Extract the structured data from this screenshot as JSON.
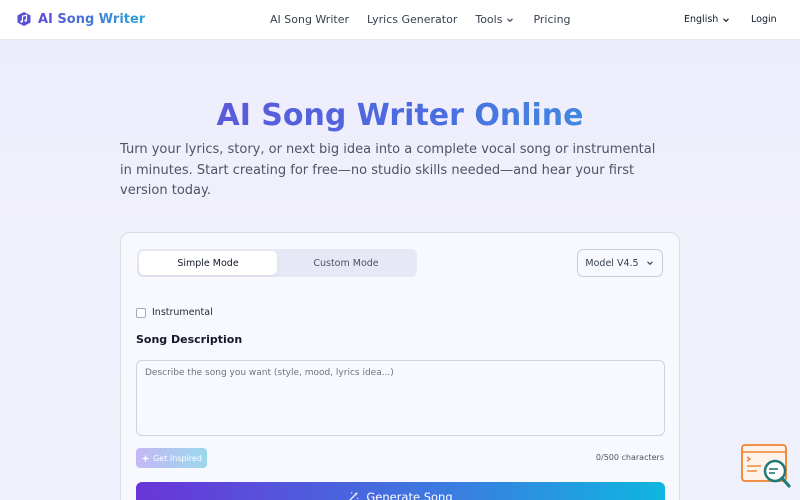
{
  "navbar": {
    "brand": "AI Song Writer",
    "links": [
      "AI Song Writer",
      "Lyrics Generator",
      "Tools",
      "Pricing"
    ],
    "language": "English",
    "login": "Login"
  },
  "hero": {
    "title": "AI Song Writer Online",
    "subtitle": "Turn your lyrics, story, or next big idea into a complete vocal song or instrumental in minutes. Start creating for free—no studio skills needed—and hear your first version today."
  },
  "form": {
    "modes": [
      "Simple Mode",
      "Custom Mode"
    ],
    "active_mode": "Simple Mode",
    "model": "Model V4.5",
    "instrumental_label": "Instrumental",
    "instrumental_checked": false,
    "description_label": "Song Description",
    "description_placeholder": "Describe the song you want (style, mood, lyrics idea...)",
    "description_value": "",
    "inspire_label": "Get Inspired",
    "char_count": "0/500 characters",
    "generate_label": "Generate Song"
  },
  "colors": {
    "brand_start": "#6a45d6",
    "brand_end": "#36aee0",
    "widget_orange": "#f0822e",
    "widget_teal": "#1f7a7a"
  },
  "icons": {
    "brand": "music-logo-icon",
    "dropdown": "chevron-down-icon",
    "inspire": "sparkle-icon",
    "generate": "magic-wand-icon",
    "widget": "search-document-icon"
  }
}
